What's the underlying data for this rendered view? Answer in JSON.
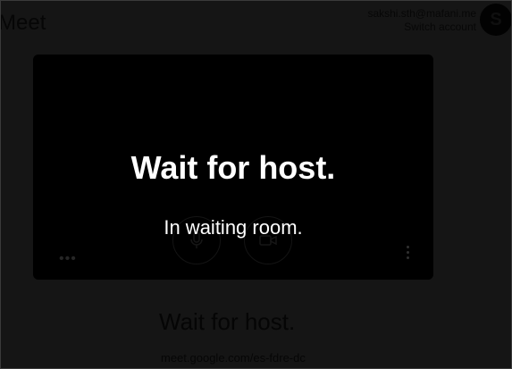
{
  "header": {
    "app_name": "Meet",
    "account_email": "sakshi.sth@mafani.me",
    "switch_account": "Switch account",
    "avatar_letter": "S"
  },
  "preview": {
    "overlay_title": "Wait for host.",
    "overlay_subtitle": "In waiting room.",
    "more_options_icon": "more-horizontal-icon",
    "side_menu_icon": "more-vertical-icon",
    "mic_icon": "microphone-icon",
    "camera_icon": "camera-icon"
  },
  "background": {
    "title": "Wait for host.",
    "meeting_link": "meet.google.com/es-fdre-dc"
  },
  "colors": {
    "overlay_text": "#ffffff",
    "preview_bg": "#000000",
    "page_dim": "#151515"
  }
}
